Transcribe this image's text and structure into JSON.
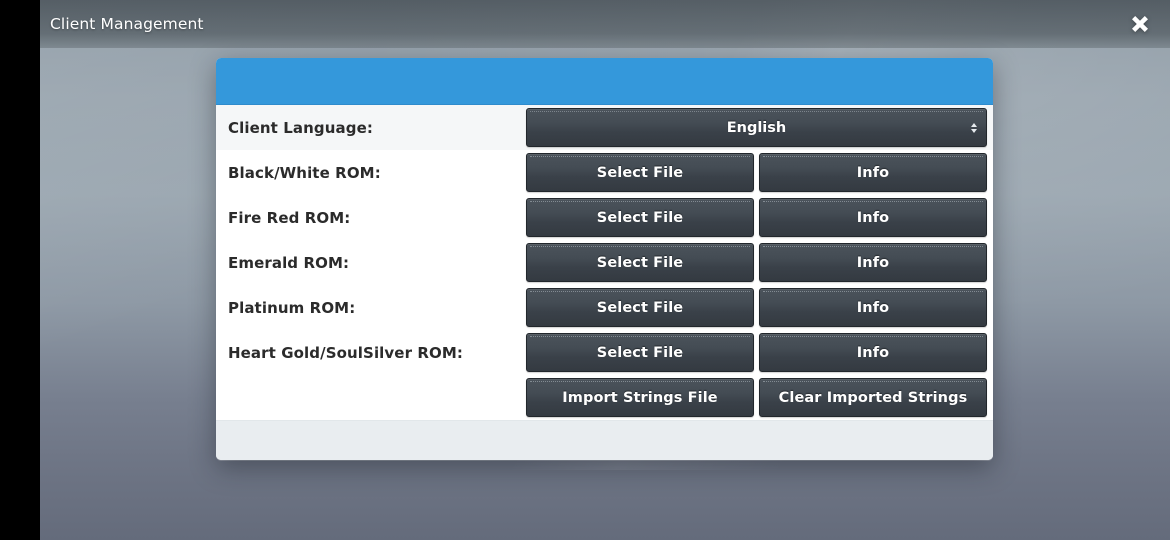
{
  "window": {
    "title": "Client Management",
    "close_icon": "close-icon",
    "titlebar_color": "#4c545a"
  },
  "dialog": {
    "header_color": "#3498db",
    "header_title": "",
    "footer_text": "",
    "language_row": {
      "label": "Client Language:",
      "value": "English",
      "stepper_icon": "updown-stepper-icon"
    },
    "rom_rows": [
      {
        "label": "Black/White ROM:",
        "select_label": "Select File",
        "info_label": "Info"
      },
      {
        "label": "Fire Red ROM:",
        "select_label": "Select File",
        "info_label": "Info"
      },
      {
        "label": "Emerald ROM:",
        "select_label": "Select File",
        "info_label": "Info"
      },
      {
        "label": "Platinum ROM:",
        "select_label": "Select File",
        "info_label": "Info"
      },
      {
        "label": "Heart Gold/SoulSilver ROM:",
        "select_label": "Select File",
        "info_label": "Info"
      }
    ],
    "strings_row": {
      "import_label": "Import Strings File",
      "clear_label": "Clear Imported Strings"
    }
  }
}
